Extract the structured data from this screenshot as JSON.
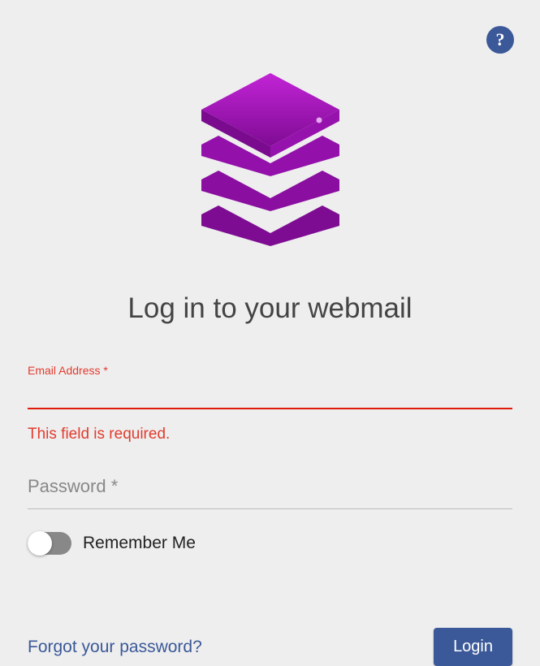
{
  "help_tooltip": "?",
  "title": "Log in to your webmail",
  "email": {
    "label": "Email Address *",
    "value": "",
    "error": "This field is required."
  },
  "password": {
    "placeholder": "Password *"
  },
  "remember": {
    "label": "Remember Me",
    "on": false
  },
  "forgot_label": "Forgot your password?",
  "login_label": "Login",
  "colors": {
    "accent": "#3b5998",
    "logo": "#a40fb7",
    "error": "#e23b2e"
  }
}
